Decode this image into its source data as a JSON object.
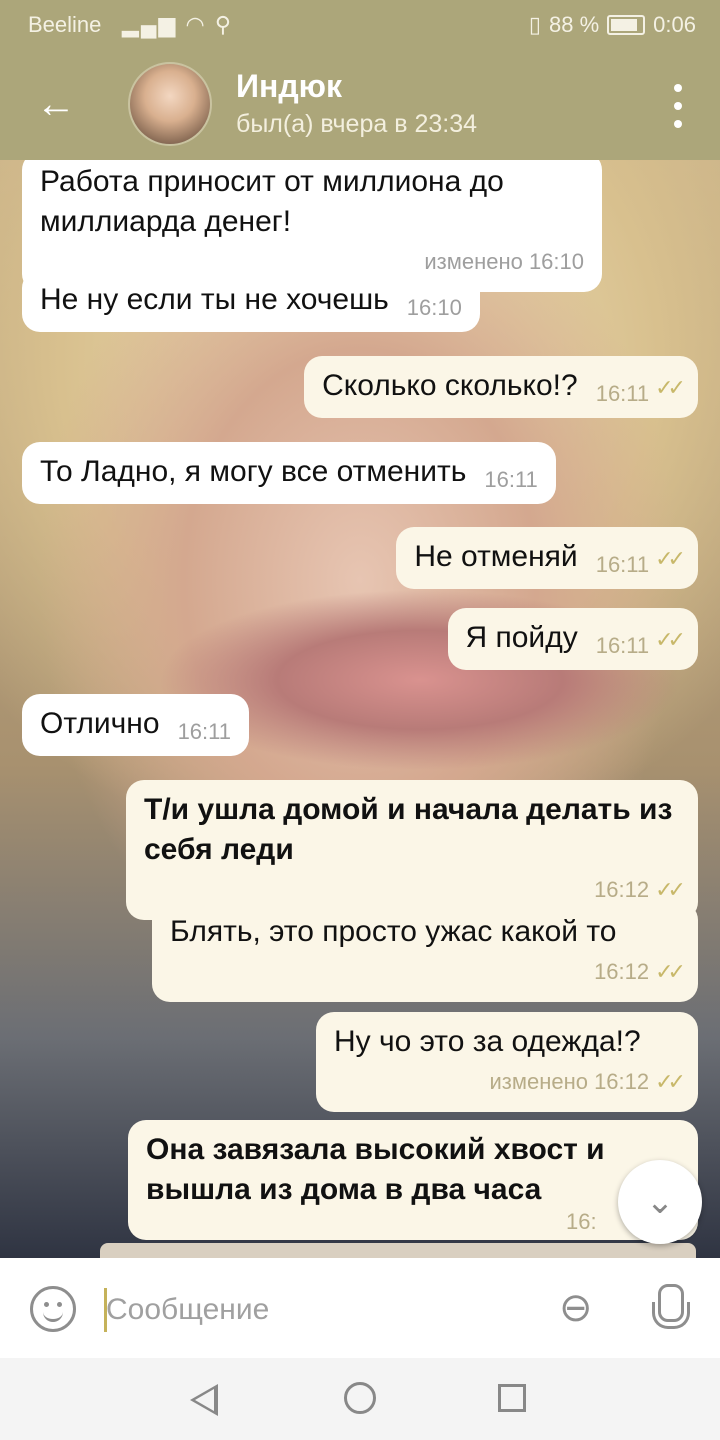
{
  "status_bar": {
    "carrier": "Beeline",
    "battery": "88 %",
    "time": "0:06"
  },
  "header": {
    "back_icon": "arrow-left-icon",
    "contact_name": "Индюк",
    "last_seen": "был(а) вчера в 23:34",
    "menu_icon": "more-vertical-icon"
  },
  "messages": [
    {
      "direction": "in",
      "text": "Работа приносит от миллиона до миллиарда денег!",
      "time": "изменено 16:10"
    },
    {
      "direction": "in",
      "text": "Не ну если ты не хочешь",
      "time": "16:10"
    },
    {
      "direction": "out",
      "text": "Сколько сколько!?",
      "time": "16:11"
    },
    {
      "direction": "in",
      "text": "То Ладно, я могу все отменить",
      "time": "16:11"
    },
    {
      "direction": "out",
      "text": "Не отменяй",
      "time": "16:11"
    },
    {
      "direction": "out",
      "text": "Я пойду",
      "time": "16:11"
    },
    {
      "direction": "in",
      "text": "Отлично",
      "time": "16:11"
    },
    {
      "direction": "out",
      "text": "Т/и ушла домой и начала делать из себя леди",
      "time": "16:12",
      "bold": true
    },
    {
      "direction": "out",
      "text": "Блять, это просто ужас какой то",
      "time": "16:12"
    },
    {
      "direction": "out",
      "text": "Ну чо это за одежда!?",
      "time": "изменено 16:12"
    },
    {
      "direction": "out",
      "text": "Она завязала высокий хвост и вышла из дома в два часа",
      "time": "16:",
      "bold": true
    }
  ],
  "read_ticks": "✓✓",
  "input": {
    "placeholder": "Сообщение",
    "emoji_icon": "smile-icon",
    "attach_icon": "paperclip-icon",
    "mic_icon": "microphone-icon"
  },
  "scroll_down_icon": "chevron-down-icon",
  "nav": {
    "back_icon": "triangle-back-icon",
    "home_icon": "circle-home-icon",
    "recent_icon": "square-recent-icon"
  }
}
